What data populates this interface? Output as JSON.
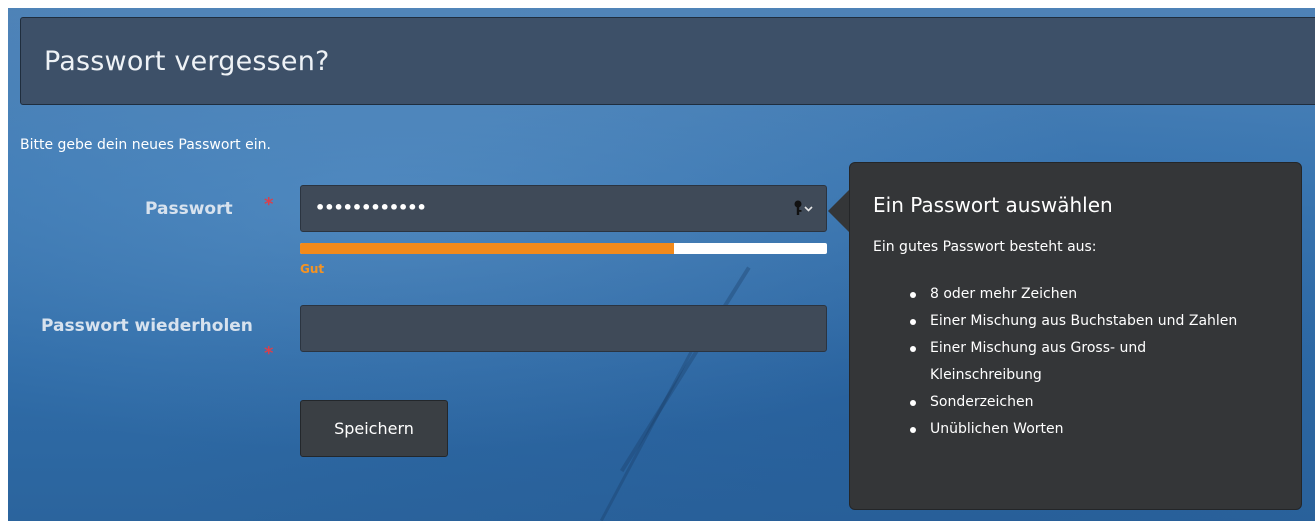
{
  "header": {
    "title": "Passwort vergessen?"
  },
  "form": {
    "intro": "Bitte gebe dein neues Passwort ein.",
    "required_marker": "*",
    "password": {
      "label": "Passwort",
      "value_masked": "••••••••••••",
      "strength_label": "Gut",
      "strength_percent": 71,
      "key_icon": "key-dropdown-icon"
    },
    "password_repeat": {
      "label": "Passwort wiederholen",
      "value": ""
    },
    "save_label": "Speichern"
  },
  "tooltip": {
    "title": "Ein Passwort auswählen",
    "subtitle": "Ein gutes Passwort besteht aus:",
    "items": [
      "8 oder mehr Zeichen",
      "Einer Mischung aus Buchstaben und Zahlen",
      "Einer Mischung aus Gross- und Kleinschreibung",
      "Sonderzeichen",
      "Unüblichen Worten"
    ]
  },
  "colors": {
    "strength": "#f28a1b",
    "required": "#d8404d",
    "header_bg": "#3d5068",
    "tooltip_bg": "#343638"
  }
}
